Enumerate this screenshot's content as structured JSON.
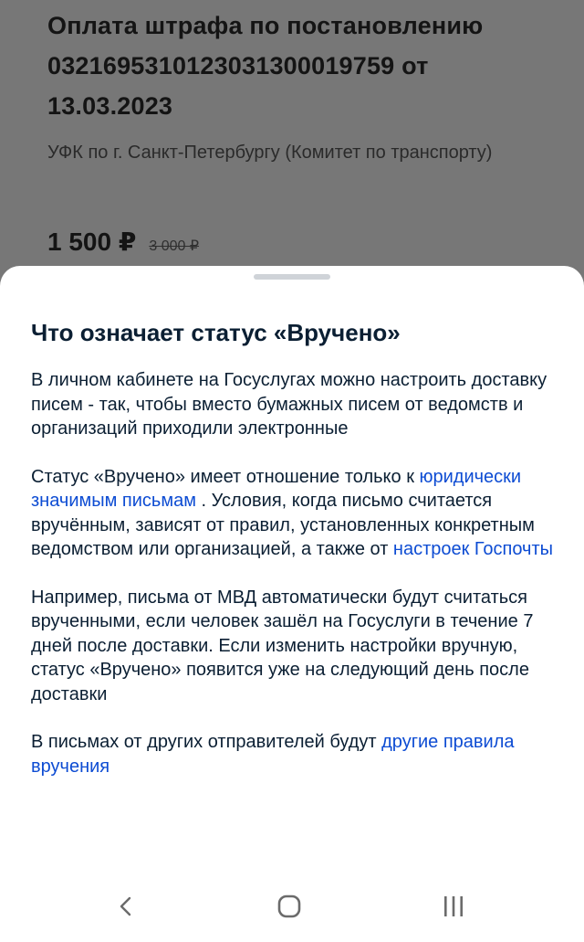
{
  "background": {
    "title": "Оплата штрафа по постановлению 03216953101230313000197​59 от 13.03.2023",
    "org": "УФК по г. Санкт-Петербургу (Комитет по транспорту)",
    "price": "1 500 ₽",
    "old_price": "3 000 ₽"
  },
  "sheet": {
    "title": "Что означает статус «Вручено»",
    "p1": "В личном кабинете на Госуслугах можно настроить доставку писем - так, чтобы вместо бумажных писем от ведомств и организаций приходили электронные",
    "p2_before": "Статус «Вручено» имеет отношение только к ",
    "p2_link1": "юридически значимым письмам",
    "p2_middle": " . Условия, когда письмо считается вручённым, зависят от правил, установленных конкретным ведомством или организацией, а также от ",
    "p2_link2": "настроек Госпочты",
    "p3": "Например, письма от МВД автоматически будут считаться врученными, если человек зашёл на Госуслуги в течение 7 дней после доставки. Если изменить настройки вручную, статус «Вручено» появится уже на следующий день после доставки",
    "p4_before": "В письмах от других отправителей будут ",
    "p4_link": "другие правила вручения"
  },
  "nav": {
    "back_icon": "chevron-left",
    "home_icon": "rounded-square",
    "recent_icon": "three-bars"
  },
  "colors": {
    "link": "#0d4cd3",
    "text": "#0b1f33",
    "overlay": "#777777"
  }
}
